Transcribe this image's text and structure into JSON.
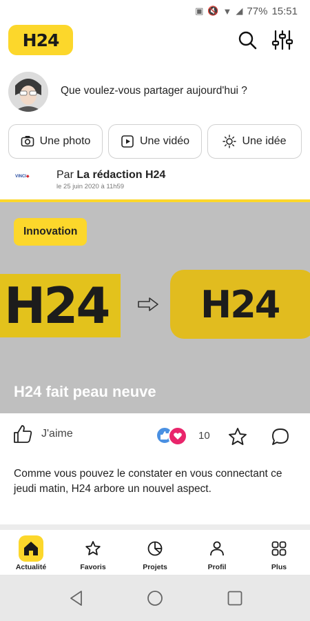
{
  "status_bar": {
    "battery": "77%",
    "time": "15:51"
  },
  "app": {
    "logo_text": "H24"
  },
  "composer": {
    "prompt": "Que voulez-vous partager aujourd'hui ?",
    "chips": [
      {
        "label": "Une photo",
        "icon": "camera-icon"
      },
      {
        "label": "Une vidéo",
        "icon": "video-icon"
      },
      {
        "label": "Une idée",
        "icon": "lightbulb-icon"
      }
    ]
  },
  "post": {
    "author_prefix": "Par",
    "author": "La rédaction H24",
    "date": "le 25 juin 2020 à 11h59",
    "source_logo_text": "VINCI",
    "tag": "Innovation",
    "hero_old_text": "H24",
    "hero_new_text": "H24",
    "title": "H24 fait peau neuve",
    "like_label": "J'aime",
    "reaction_count": "10",
    "excerpt": "Comme vous pouvez le constater en vous connectant ce jeudi matin, H24 arbore un nouvel aspect."
  },
  "bottom_nav": [
    {
      "label": "Actualité",
      "icon": "home-icon",
      "active": true
    },
    {
      "label": "Favoris",
      "icon": "star-icon",
      "active": false
    },
    {
      "label": "Projets",
      "icon": "pie-chart-icon",
      "active": false
    },
    {
      "label": "Profil",
      "icon": "person-icon",
      "active": false
    },
    {
      "label": "Plus",
      "icon": "grid-icon",
      "active": false
    }
  ],
  "colors": {
    "brand_yellow": "#fcd72b",
    "hero_bg": "#bfbfbf",
    "like_blue": "#4a90e2",
    "love_pink": "#e9256b"
  }
}
